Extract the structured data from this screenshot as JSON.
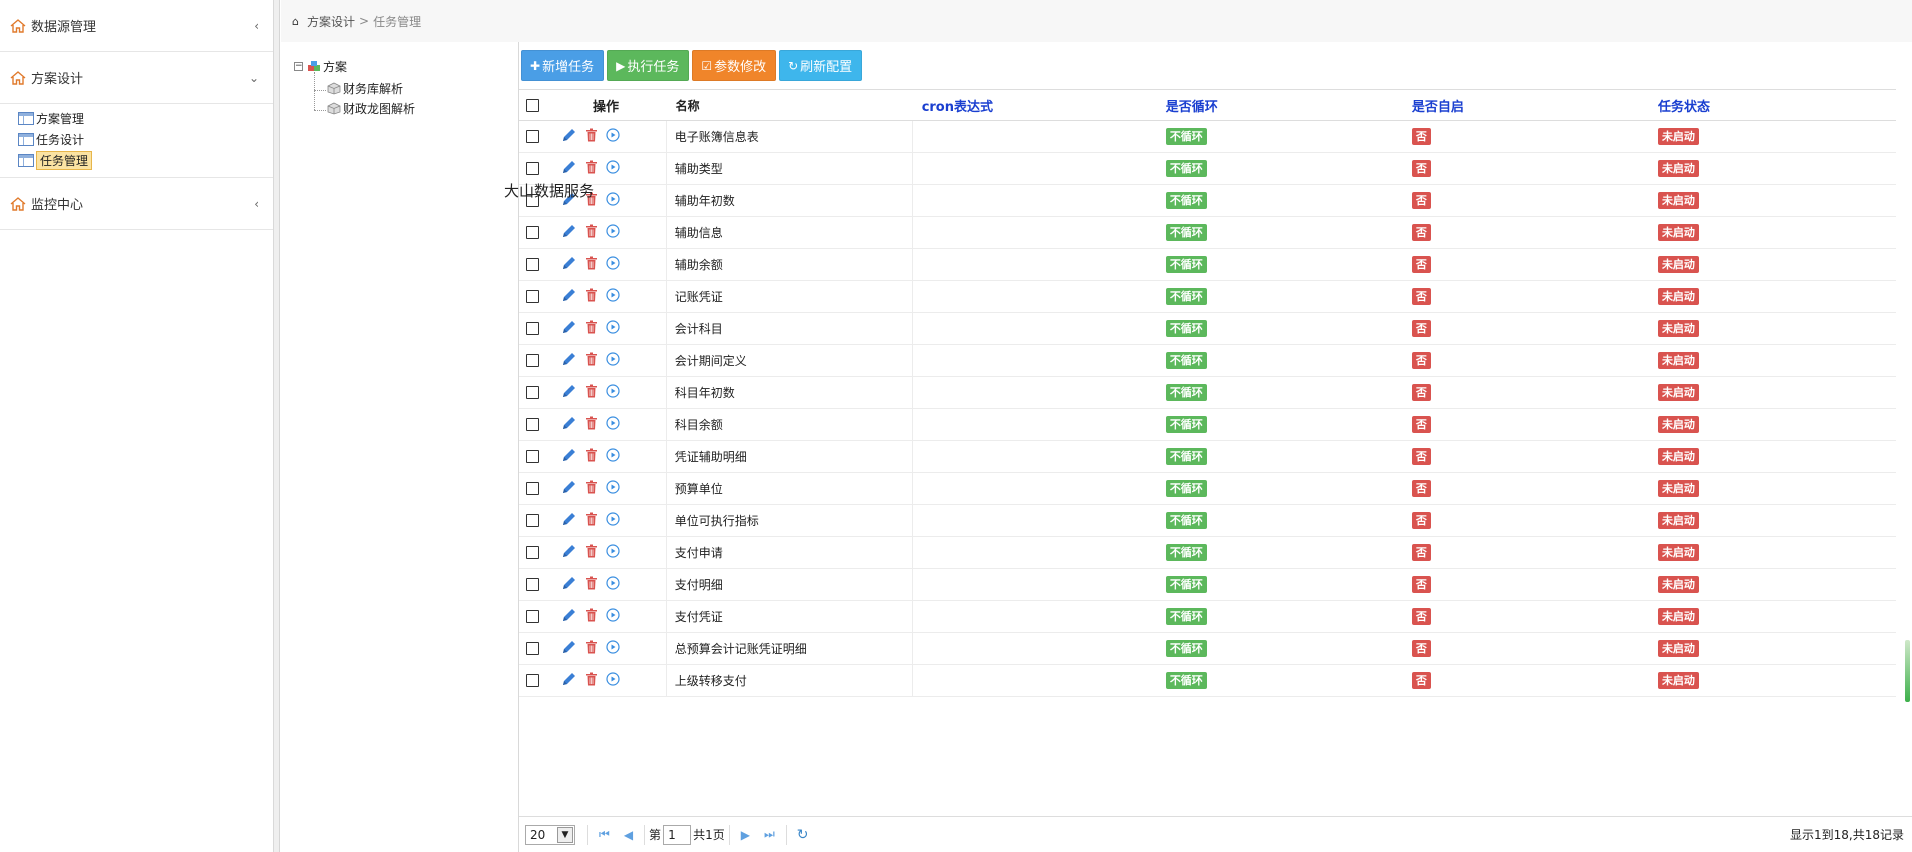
{
  "nav": {
    "groups": [
      {
        "label": "数据源管理",
        "chevron": "‹"
      },
      {
        "label": "方案设计",
        "chevron": "⌄"
      },
      {
        "label": "监控中心",
        "chevron": "‹"
      }
    ],
    "sub_items": [
      {
        "label": "方案管理"
      },
      {
        "label": "任务设计"
      },
      {
        "label": "任务管理"
      }
    ]
  },
  "breadcrumb": {
    "first": "方案设计",
    "sep": ">",
    "last": "任务管理"
  },
  "tree": {
    "root": "方案",
    "children": [
      "财务库解析",
      "财政龙图解析"
    ],
    "toggle": "−"
  },
  "overlay_text": "大山数据服务",
  "toolbar": {
    "add": "新增任务",
    "run": "执行任务",
    "param": "参数修改",
    "refresh": "刷新配置"
  },
  "grid": {
    "headers": {
      "ops": "操作",
      "name": "名称",
      "cron": "cron表达式",
      "loop": "是否循环",
      "auto": "是否自启",
      "status": "任务状态"
    },
    "rows": [
      {
        "name": "电子账簿信息表",
        "loop": "不循环",
        "auto": "否",
        "status": "未启动"
      },
      {
        "name": "辅助类型",
        "loop": "不循环",
        "auto": "否",
        "status": "未启动"
      },
      {
        "name": "辅助年初数",
        "loop": "不循环",
        "auto": "否",
        "status": "未启动"
      },
      {
        "name": "辅助信息",
        "loop": "不循环",
        "auto": "否",
        "status": "未启动"
      },
      {
        "name": "辅助余额",
        "loop": "不循环",
        "auto": "否",
        "status": "未启动"
      },
      {
        "name": "记账凭证",
        "loop": "不循环",
        "auto": "否",
        "status": "未启动"
      },
      {
        "name": "会计科目",
        "loop": "不循环",
        "auto": "否",
        "status": "未启动"
      },
      {
        "name": "会计期间定义",
        "loop": "不循环",
        "auto": "否",
        "status": "未启动"
      },
      {
        "name": "科目年初数",
        "loop": "不循环",
        "auto": "否",
        "status": "未启动"
      },
      {
        "name": "科目余额",
        "loop": "不循环",
        "auto": "否",
        "status": "未启动"
      },
      {
        "name": "凭证辅助明细",
        "loop": "不循环",
        "auto": "否",
        "status": "未启动"
      },
      {
        "name": "预算单位",
        "loop": "不循环",
        "auto": "否",
        "status": "未启动"
      },
      {
        "name": "单位可执行指标",
        "loop": "不循环",
        "auto": "否",
        "status": "未启动"
      },
      {
        "name": "支付申请",
        "loop": "不循环",
        "auto": "否",
        "status": "未启动"
      },
      {
        "name": "支付明细",
        "loop": "不循环",
        "auto": "否",
        "status": "未启动"
      },
      {
        "name": "支付凭证",
        "loop": "不循环",
        "auto": "否",
        "status": "未启动"
      },
      {
        "name": "总预算会计记账凭证明细",
        "loop": "不循环",
        "auto": "否",
        "status": "未启动"
      },
      {
        "name": "上级转移支付",
        "loop": "不循环",
        "auto": "否",
        "status": "未启动"
      }
    ]
  },
  "pager": {
    "page_size": "20",
    "page_prefix": "第",
    "page_num": "1",
    "page_total": "共1页",
    "info": "显示1到18,共18记录"
  },
  "colors": {
    "link_blue": "#1a3fd0",
    "green": "#5cb85c",
    "red": "#d9534f",
    "orange": "#f0852a"
  }
}
